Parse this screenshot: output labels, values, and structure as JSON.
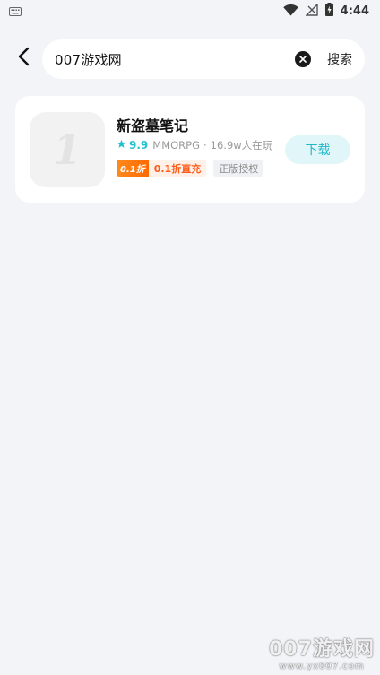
{
  "status_bar": {
    "time": "4:44",
    "icons": [
      "keyboard-icon",
      "wifi-icon",
      "no-signal-icon",
      "battery-charging-icon"
    ]
  },
  "search": {
    "query": "007游戏网",
    "search_button_label": "搜索",
    "icons": [
      "back-arrow-icon",
      "clear-icon"
    ]
  },
  "results": [
    {
      "name": "新盗墓笔记",
      "icon": "app-placeholder-icon",
      "icon_glyph": "1",
      "rating": "9.9",
      "genre": "MMORPG",
      "players": "16.9w人在玩",
      "separator": "·",
      "discount_badge": "0.1折",
      "discount_text": "0.1折直充",
      "official_tag": "正版授权",
      "download_label": "下载"
    }
  ],
  "watermark": {
    "title": "007游戏网",
    "url": "www.yx007.com"
  },
  "colors": {
    "background": "#f3f4f8",
    "accent": "#20b8c8",
    "rating": "#24c0cf",
    "discount": "#ff6a00"
  }
}
